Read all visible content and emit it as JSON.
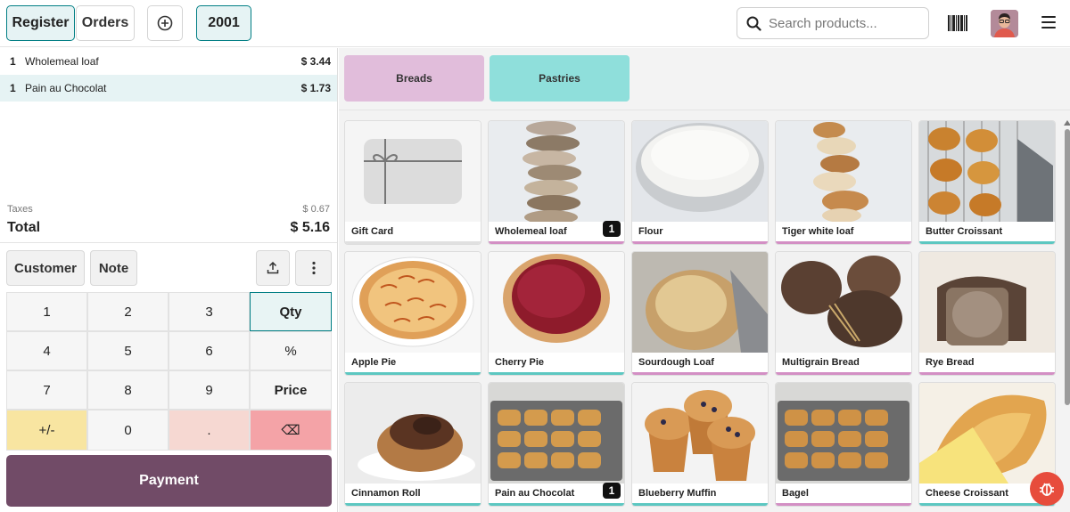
{
  "topbar": {
    "register_label": "Register",
    "orders_label": "Orders",
    "order_tab_label": "2001",
    "search_placeholder": "Search products...",
    "icons": [
      "plus-circle-icon",
      "search-icon",
      "barcode-icon",
      "avatar",
      "hamburger-menu-icon"
    ]
  },
  "order": {
    "lines": [
      {
        "qty": "1",
        "name": "Wholemeal loaf",
        "price": "$ 3.44"
      },
      {
        "qty": "1",
        "name": "Pain au Chocolat",
        "price": "$ 1.73"
      }
    ],
    "taxes_label": "Taxes",
    "taxes_value": "$ 0.67",
    "total_label": "Total",
    "total_value": "$ 5.16"
  },
  "controls": {
    "customer_label": "Customer",
    "note_label": "Note"
  },
  "numpad": {
    "keys": [
      "1",
      "2",
      "3",
      "Qty",
      "4",
      "5",
      "6",
      "%",
      "7",
      "8",
      "9",
      "Price",
      "+/-",
      "0",
      ".",
      "⌫"
    ]
  },
  "payment_label": "Payment",
  "categories": [
    {
      "label": "Breads",
      "color": "#e1bddb"
    },
    {
      "label": "Pastries",
      "color": "#8fdfdb"
    }
  ],
  "products": [
    {
      "name": "Gift Card",
      "category": "none",
      "badge": ""
    },
    {
      "name": "Wholemeal loaf",
      "category": "bread",
      "badge": "1"
    },
    {
      "name": "Flour",
      "category": "bread",
      "badge": ""
    },
    {
      "name": "Tiger white loaf",
      "category": "bread",
      "badge": ""
    },
    {
      "name": "Butter Croissant",
      "category": "pastry",
      "badge": ""
    },
    {
      "name": "Apple Pie",
      "category": "pastry",
      "badge": ""
    },
    {
      "name": "Cherry Pie",
      "category": "pastry",
      "badge": ""
    },
    {
      "name": "Sourdough Loaf",
      "category": "bread",
      "badge": ""
    },
    {
      "name": "Multigrain Bread",
      "category": "bread",
      "badge": ""
    },
    {
      "name": "Rye Bread",
      "category": "bread",
      "badge": ""
    },
    {
      "name": "Cinnamon Roll",
      "category": "pastry",
      "badge": ""
    },
    {
      "name": "Pain au Chocolat",
      "category": "pastry",
      "badge": "1"
    },
    {
      "name": "Blueberry Muffin",
      "category": "pastry",
      "badge": ""
    },
    {
      "name": "Bagel",
      "category": "bread",
      "badge": ""
    },
    {
      "name": "Cheese Croissant",
      "category": "pastry",
      "badge": ""
    }
  ],
  "colors": {
    "accent": "#017e84",
    "brand": "#714b67",
    "bread_tag": "#d38fc4",
    "pastry_tag": "#5cc7c1"
  }
}
